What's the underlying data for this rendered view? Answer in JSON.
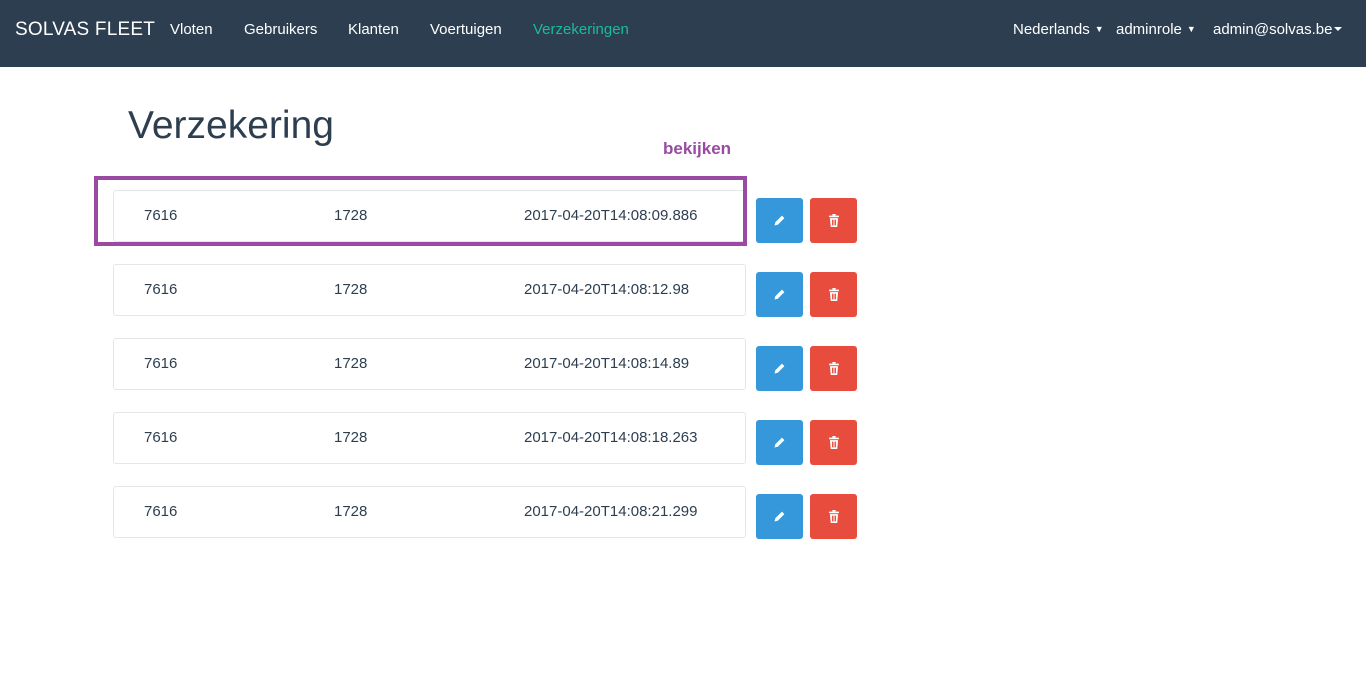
{
  "navbar": {
    "brand": "SOLVAS FLEET",
    "items": [
      {
        "label": "Vloten"
      },
      {
        "label": "Gebruikers"
      },
      {
        "label": "Klanten"
      },
      {
        "label": "Voertuigen"
      },
      {
        "label": "Verzekeringen",
        "active": true
      }
    ],
    "right": {
      "language": "Nederlands",
      "role": "adminrole",
      "user": "admin@solvas.be"
    },
    "colors": {
      "background": "#2c3e50",
      "active": "#18bc9c"
    }
  },
  "page": {
    "title": "Verzekering"
  },
  "annotation": {
    "label": "bekijken",
    "color": "#9b4aa3"
  },
  "rows": [
    {
      "col1": "7616",
      "col2": "1728",
      "col3": "2017-04-20T14:08:09.886"
    },
    {
      "col1": "7616",
      "col2": "1728",
      "col3": "2017-04-20T14:08:12.98"
    },
    {
      "col1": "7616",
      "col2": "1728",
      "col3": "2017-04-20T14:08:14.89"
    },
    {
      "col1": "7616",
      "col2": "1728",
      "col3": "2017-04-20T14:08:18.263"
    },
    {
      "col1": "7616",
      "col2": "1728",
      "col3": "2017-04-20T14:08:21.299"
    }
  ],
  "actions": {
    "edit_icon": "pencil-icon",
    "delete_icon": "trash-icon",
    "edit_color": "#3498db",
    "delete_color": "#e74c3c"
  }
}
